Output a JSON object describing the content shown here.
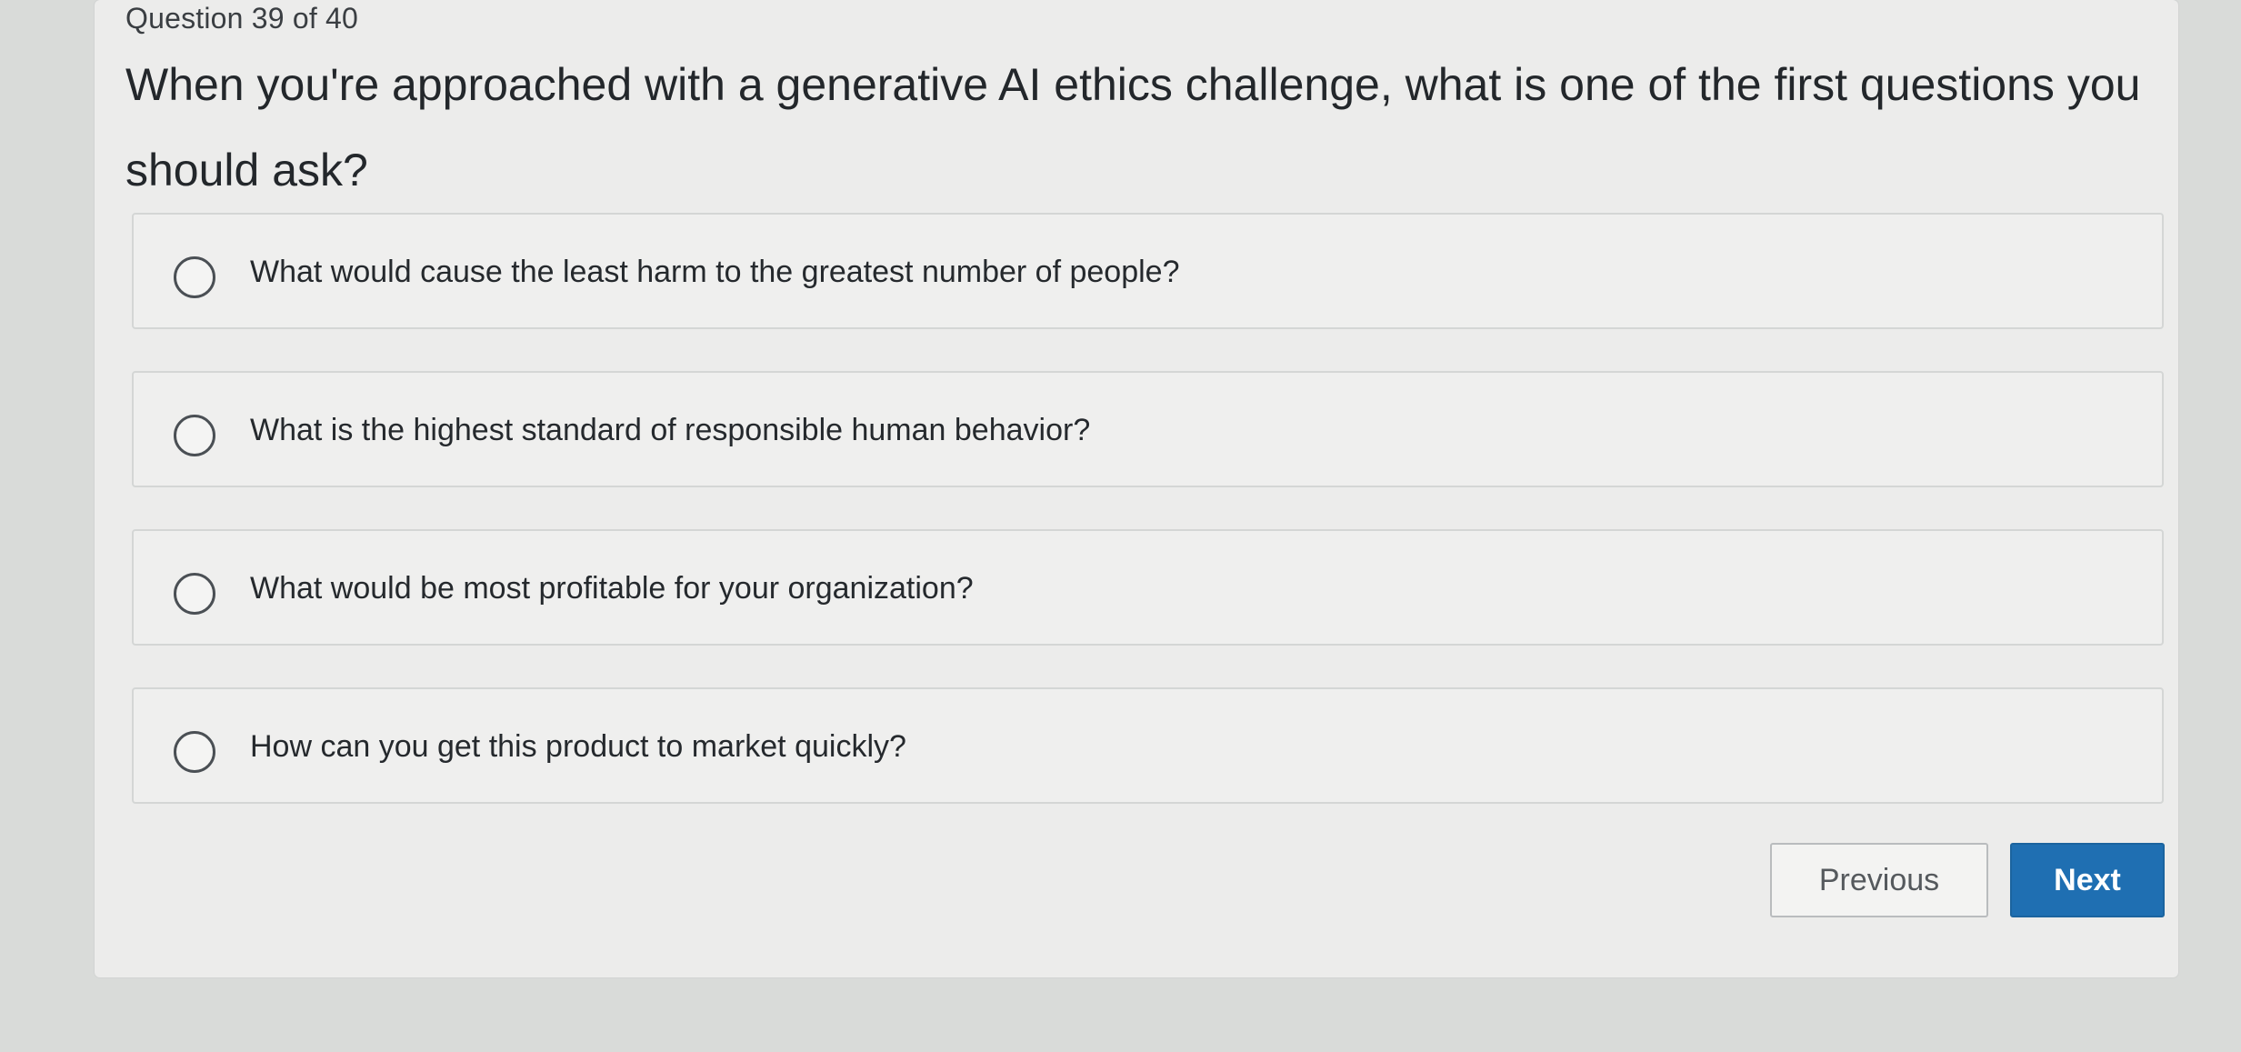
{
  "quiz": {
    "counter": "Question 39 of 40",
    "question": "When you're approached with a generative AI ethics challenge, what is one of the first questions you should ask?",
    "options": [
      {
        "label": "What would cause the least harm to the greatest number of people?"
      },
      {
        "label": "What is the highest standard of responsible human behavior?"
      },
      {
        "label": "What would be most profitable for your organization?"
      },
      {
        "label": "How can you get this product to market quickly?"
      }
    ]
  },
  "navigation": {
    "previous_label": "Previous",
    "next_label": "Next"
  },
  "colors": {
    "accent": "#1f6fb2",
    "background": "#d9dbd9",
    "card": "#ececeb"
  }
}
